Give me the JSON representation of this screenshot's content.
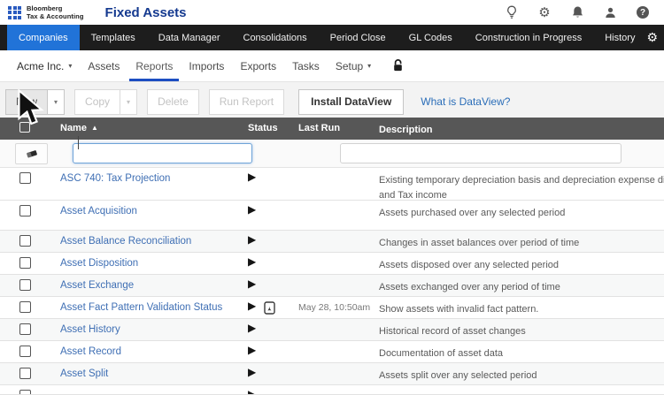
{
  "header": {
    "logo_line1": "Bloomberg",
    "logo_line2": "Tax & Accounting",
    "app_title": "Fixed Assets"
  },
  "icons": {
    "caret_down": "▾",
    "play": "▶",
    "sort_asc": "▲",
    "gear": "⚙",
    "help": "?"
  },
  "main_nav": {
    "items": [
      {
        "label": "Companies",
        "active": true
      },
      {
        "label": "Templates",
        "active": false
      },
      {
        "label": "Data Manager",
        "active": false
      },
      {
        "label": "Consolidations",
        "active": false
      },
      {
        "label": "Period Close",
        "active": false
      },
      {
        "label": "GL Codes",
        "active": false
      },
      {
        "label": "Construction in Progress",
        "active": false
      },
      {
        "label": "History",
        "active": false
      }
    ]
  },
  "sub_nav": {
    "company": "Acme Inc.",
    "tabs": [
      "Assets",
      "Reports",
      "Imports",
      "Exports",
      "Tasks"
    ],
    "setup_label": "Setup",
    "active_tab": "Reports"
  },
  "toolbar": {
    "new_label": "New",
    "copy_label": "Copy",
    "delete_label": "Delete",
    "run_report_label": "Run Report",
    "install_dataview_label": "Install DataView",
    "dataview_link": "What is DataView?"
  },
  "table": {
    "columns": {
      "name": "Name",
      "status": "Status",
      "last_run": "Last Run",
      "description": "Description"
    },
    "filter": {
      "name_value": "",
      "description_value": ""
    },
    "rows": [
      {
        "name": "ASC 740: Tax Projection",
        "description": "Existing temporary depreciation basis and depreciation expense differences between Book and Tax income"
      },
      {
        "name": "Asset Acquisition",
        "description": "Assets purchased over any selected period"
      },
      {
        "name": "Asset Balance Reconciliation",
        "description": "Changes in asset balances over period of time"
      },
      {
        "name": "Asset Disposition",
        "description": "Assets disposed over any selected period"
      },
      {
        "name": "Asset Exchange",
        "description": "Assets exchanged over any period of time"
      },
      {
        "name": "Asset Fact Pattern Validation Status",
        "has_pdf": true,
        "last_run": "May 28, 10:50am",
        "description": "Show assets with invalid fact pattern."
      },
      {
        "name": "Asset History",
        "description": "Historical record of asset changes"
      },
      {
        "name": "Asset Record",
        "description": "Documentation of asset data"
      },
      {
        "name": "Asset Split",
        "description": "Assets split over any selected period"
      }
    ]
  },
  "colors": {
    "accent_blue": "#2173d8",
    "nav_bg": "#1d1d1d",
    "active_underline": "#1d4ec2",
    "table_header_bg": "#575757",
    "link_blue": "#3f6fb4",
    "title_navy": "#14398f"
  }
}
